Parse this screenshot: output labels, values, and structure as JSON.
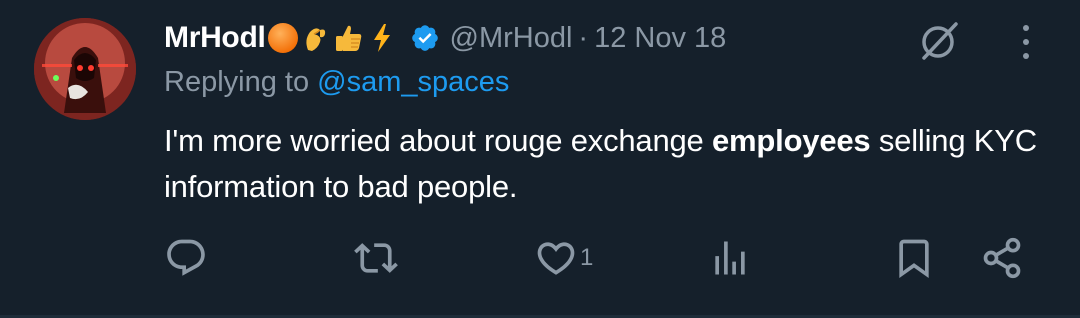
{
  "tweet": {
    "display_name": "MrHodl",
    "name_emojis": [
      "orange-circle",
      "pinching-hand",
      "thumbs-up",
      "high-voltage"
    ],
    "verified": true,
    "handle": "@MrHodl",
    "separator": "·",
    "date": "12 Nov 18",
    "replying_prefix": "Replying to ",
    "replying_to": "@sam_spaces",
    "text_before_bold": "I'm more worried about rouge exchange ",
    "text_bold": "employees",
    "text_after_bold": " selling KYC information to bad people."
  },
  "actions": {
    "reply_count": "",
    "retweet_count": "",
    "like_count": "1",
    "views_count": ""
  },
  "colors": {
    "background": "#15202b",
    "muted": "#8b98a5",
    "accent": "#1d9bf0"
  }
}
